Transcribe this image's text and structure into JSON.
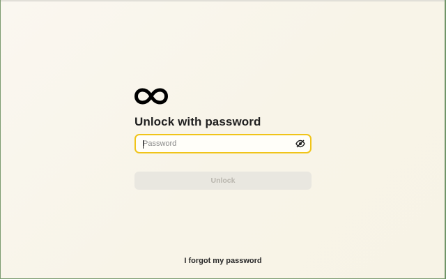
{
  "logo": {
    "icon": "infinity-icon",
    "color": "#000000"
  },
  "title": "Unlock with password",
  "password": {
    "value": "",
    "placeholder": "Password",
    "toggle_icon": "eye-off-icon",
    "focus_color": "#f0c419"
  },
  "unlock_button": {
    "label": "Unlock",
    "disabled": true
  },
  "forgot_link": {
    "label": "I forgot my password"
  }
}
